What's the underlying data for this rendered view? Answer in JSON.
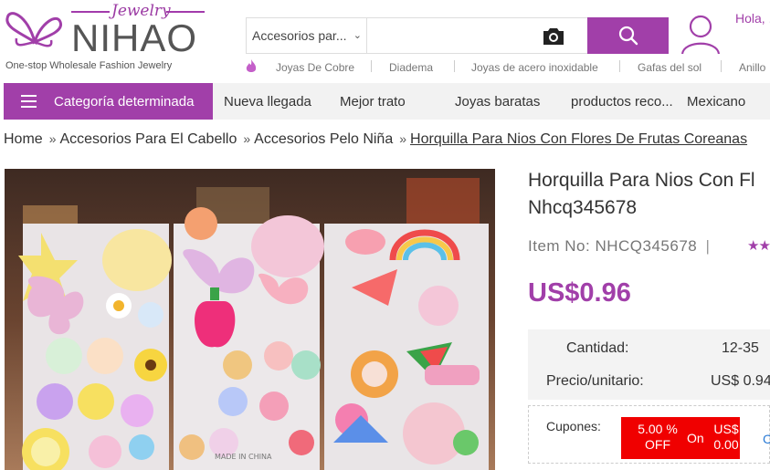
{
  "logo": {
    "brand": "NIHAO",
    "script": "Jewelry",
    "tagline": "One-stop Wholesale Fashion Jewelry"
  },
  "search": {
    "category": "Accesorios par...",
    "query": ""
  },
  "user": {
    "greeting": "Hola, ..."
  },
  "hot_links": [
    "Joyas De Cobre",
    "Diadema",
    "Joyas de acero inoxidable",
    "Gafas del sol",
    "Anillo"
  ],
  "nav": {
    "category_label": "Categoría determinada",
    "items": [
      "Nueva llegada",
      "Mejor trato",
      "Joyas baratas",
      "productos reco...",
      "Mexicano"
    ]
  },
  "breadcrumb": {
    "items": [
      "Home",
      "Accesorios Para El Cabello",
      "Accesorios Pelo Niña"
    ],
    "current": "Horquilla Para Nios Con Flores De Frutas Coreanas"
  },
  "product": {
    "title_line1": "Horquilla Para Nios Con Fl",
    "title_line2": "Nhcq345678",
    "item_no": "Item No: NHCQ345678",
    "item_sep": "|",
    "rating_stars": "★★",
    "price": "US$0.96",
    "image_watermark": "MADE IN CHINA"
  },
  "pricing": {
    "qty_label": "Cantidad:",
    "qty_value": "12-35",
    "unit_label": "Precio/unitario:",
    "unit_value": "US$ 0.94"
  },
  "coupons": {
    "label": "Cupones:",
    "percent_line1": "5.00 %",
    "percent_line2": "OFF",
    "on": "On",
    "amount_line1": "US$",
    "amount_line2": "0.00",
    "more": "C"
  },
  "colors": {
    "accent": "#a13fa9",
    "coupon_red": "#f00000",
    "link_blue": "#2a7ad6"
  }
}
